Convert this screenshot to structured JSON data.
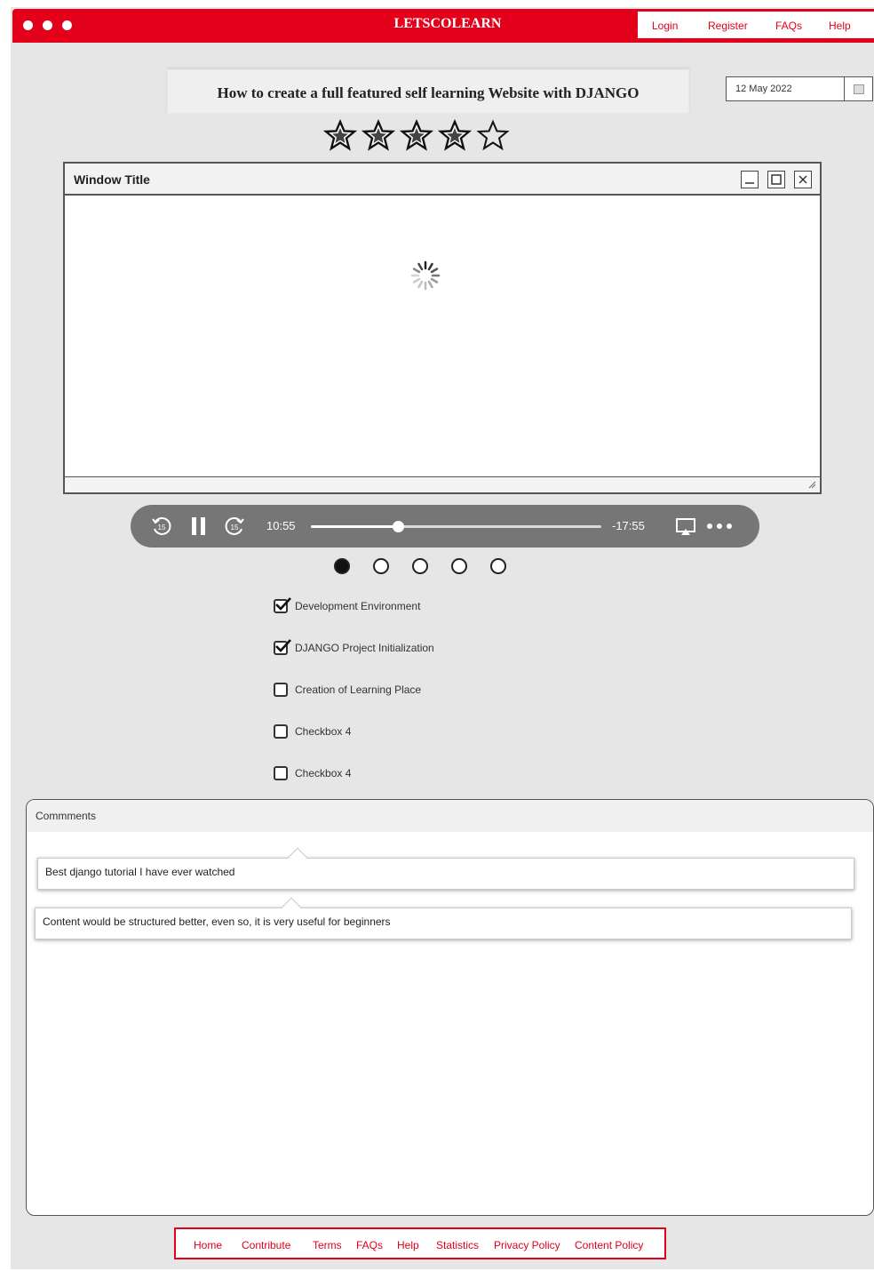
{
  "header": {
    "brand": "LETSCOLEARN",
    "nav": [
      "Login",
      "Register",
      "FAQs",
      "Help"
    ],
    "accent_color": "#e2001a"
  },
  "course": {
    "title": "How to create a full featured self learning Website with DJANGO",
    "date": "12 May 2022",
    "rating": {
      "value": 4,
      "max": 5
    }
  },
  "video_window": {
    "title": "Window Title",
    "state": "loading",
    "controls": [
      "minimize-icon",
      "maximize-icon",
      "close-icon"
    ]
  },
  "player": {
    "elapsed": "10:55",
    "remaining": "-17:55",
    "progress": 0.3,
    "icons": [
      "rewind-15-icon",
      "pause-icon",
      "forward-15-icon",
      "airplay-icon",
      "more-icon"
    ]
  },
  "pager": {
    "count": 5,
    "active": 0
  },
  "checklist": [
    {
      "label": "Development Environment",
      "checked": true
    },
    {
      "label": "DJANGO Project Initialization",
      "checked": true
    },
    {
      "label": "Creation of Learning Place",
      "checked": false
    },
    {
      "label": "Checkbox 4",
      "checked": false
    },
    {
      "label": "Checkbox 4",
      "checked": false
    }
  ],
  "comments": {
    "title": "Commments",
    "items": [
      "Best django tutorial I have ever watched",
      "Content would be structured better, even so, it is very useful for beginners"
    ]
  },
  "footer": {
    "links": [
      "Home",
      "Contribute",
      "Terms",
      "FAQs",
      "Help",
      "Statistics",
      "Privacy Policy",
      "Content Policy"
    ]
  }
}
